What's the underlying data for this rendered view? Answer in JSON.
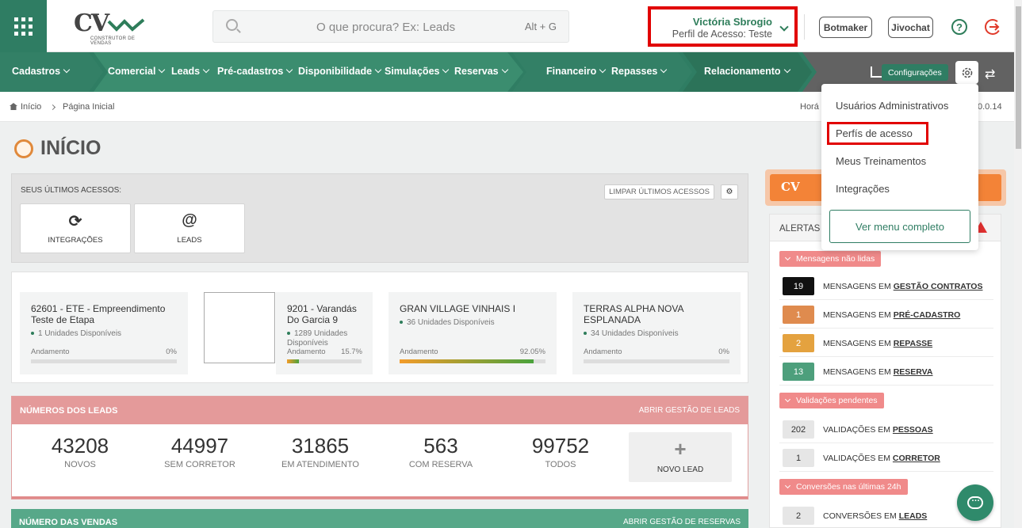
{
  "header": {
    "logo_text": "CV",
    "logo_sub": "CONSTRUTOR DE VENDAS",
    "search_placeholder": "O que procura? Ex: Leads",
    "search_shortcut": "Alt + G",
    "user_name": "Victória Sbrogio",
    "user_profile": "Perfil de Acesso: Teste",
    "botmaker_label": "Botmaker",
    "jivochat_label": "Jivochat",
    "help_glyph": "?"
  },
  "nav": {
    "items": [
      "Cadastros",
      "Comercial",
      "Leads",
      "Pré-cadastros",
      "Disponibilidade",
      "Simulações",
      "Reservas",
      "Financeiro",
      "Repasses",
      "Relacionamento"
    ],
    "config_tooltip": "Configurações"
  },
  "breadcrumb": {
    "home": "Início",
    "current": "Página Inicial",
    "right_partial": "Horá",
    "version_partial": "0.0.14"
  },
  "page": {
    "title": "INÍCIO"
  },
  "recent": {
    "label": "SEUS ÚLTIMOS ACESSOS:",
    "clear_label": "LIMPAR ÚLTIMOS ACESSOS",
    "items": [
      {
        "icon": "refresh-icon",
        "glyph": "⟳",
        "label": "INTEGRAÇÕES"
      },
      {
        "icon": "at-icon",
        "glyph": "@",
        "label": "LEADS"
      }
    ]
  },
  "projects": [
    {
      "name": "62601 - ETE - Empreendimento Teste de Etapa",
      "units": "1 Unidades Disponíveis",
      "andamento_label": "Andamento",
      "pct": "0%",
      "progress": 0
    },
    {
      "name": "9201 - Varandás Do Garcia 9",
      "units": "1289 Unidades Disponíveis",
      "andamento_label": "Andamento",
      "pct": "15.7%",
      "progress": 0.157
    },
    {
      "name": "GRAN VILLAGE VINHAIS I",
      "units": "36 Unidades Disponíveis",
      "andamento_label": "Andamento",
      "pct": "92.05%",
      "progress": 0.9205
    },
    {
      "name": "TERRAS ALPHA NOVA ESPLANADA",
      "units": "34 Unidades Disponíveis",
      "andamento_label": "Andamento",
      "pct": "0%",
      "progress": 0
    }
  ],
  "leads": {
    "title": "NÚMEROS DOS LEADS",
    "link": "ABRIR GESTÃO DE LEADS",
    "stats": [
      {
        "value": "43208",
        "label": "NOVOS"
      },
      {
        "value": "44997",
        "label": "SEM CORRETOR"
      },
      {
        "value": "31865",
        "label": "EM ATENDIMENTO"
      },
      {
        "value": "563",
        "label": "COM RESERVA"
      },
      {
        "value": "99752",
        "label": "TODOS"
      }
    ],
    "new_plus": "+",
    "new_label": "NOVO LEAD"
  },
  "sales": {
    "title": "NÚMERO DAS VENDAS",
    "link": "ABRIR GESTÃO DE RESERVAS"
  },
  "alerts": {
    "banner_logo": "CV",
    "title_partial": "ALERTAS I",
    "groups": [
      {
        "tag": "Mensagens não lidas",
        "rows": [
          {
            "count": "19",
            "color": "#111111",
            "prefix": "MENSAGENS EM ",
            "target": "GESTÃO CONTRATOS"
          },
          {
            "count": "1",
            "color": "#df8b4e",
            "prefix": "MENSAGENS EM ",
            "target": "PRÉ-CADASTRO"
          },
          {
            "count": "2",
            "color": "#e4a23f",
            "prefix": "MENSAGENS EM ",
            "target": "REPASSE"
          },
          {
            "count": "13",
            "color": "#4d9f7c",
            "prefix": "MENSAGENS EM ",
            "target": "RESERVA"
          }
        ]
      },
      {
        "tag": "Validações pendentes",
        "rows": [
          {
            "count": "202",
            "color": "#e6e6e6",
            "prefix": "VALIDAÇÕES EM ",
            "target": "PESSOAS"
          },
          {
            "count": "1",
            "color": "#e6e6e6",
            "prefix": "VALIDAÇÕES EM ",
            "target": "CORRETOR"
          }
        ]
      },
      {
        "tag": "Conversões nas últimas 24h",
        "rows": [
          {
            "count": "2",
            "color": "#e6e6e6",
            "prefix": "CONVERSÕES EM ",
            "target": "LEADS"
          }
        ]
      }
    ]
  },
  "config_menu": {
    "items": [
      "Usuários Administrativos",
      "Perfís de acesso",
      "Meus Treinamentos",
      "Integrações"
    ],
    "full_menu": "Ver menu completo"
  }
}
